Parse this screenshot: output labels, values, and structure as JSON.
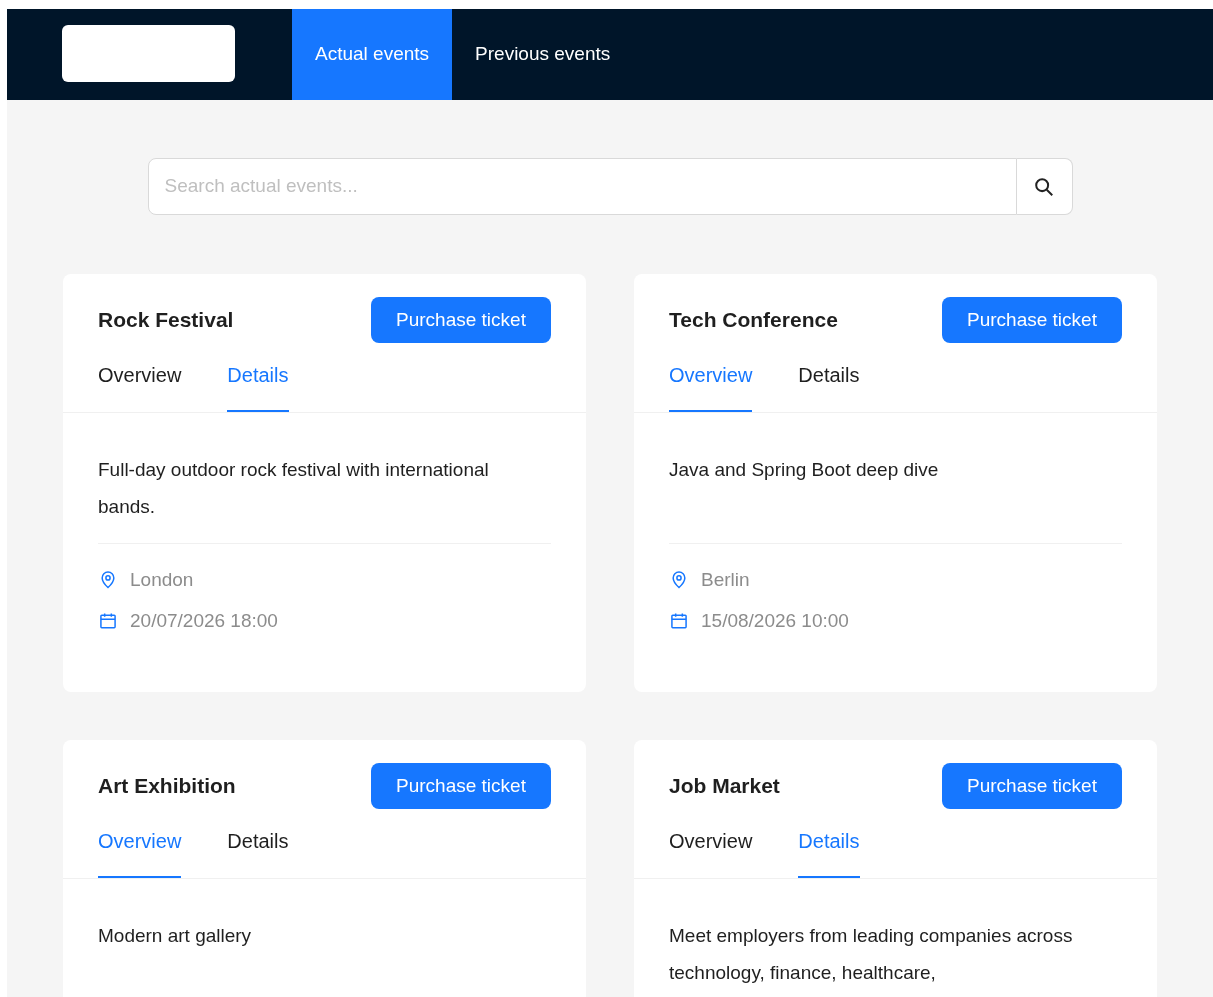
{
  "nav": {
    "tabs": [
      {
        "label": "Actual events",
        "selected": true
      },
      {
        "label": "Previous events",
        "selected": false
      }
    ]
  },
  "search": {
    "placeholder": "Search actual events..."
  },
  "events": [
    {
      "title": "Rock Festival",
      "button": "Purchase ticket",
      "tabs": [
        {
          "label": "Overview",
          "selected": false
        },
        {
          "label": "Details",
          "selected": true
        }
      ],
      "description": "Full-day outdoor rock festival with international bands.",
      "location": "London",
      "date": "20/07/2026 18:00"
    },
    {
      "title": "Tech Conference",
      "button": "Purchase ticket",
      "tabs": [
        {
          "label": "Overview",
          "selected": true
        },
        {
          "label": "Details",
          "selected": false
        }
      ],
      "description": "Java and Spring Boot deep dive",
      "location": "Berlin",
      "date": "15/08/2026 10:00"
    },
    {
      "title": "Art Exhibition",
      "button": "Purchase ticket",
      "tabs": [
        {
          "label": "Overview",
          "selected": true
        },
        {
          "label": "Details",
          "selected": false
        }
      ],
      "description": "Modern art gallery"
    },
    {
      "title": "Job Market",
      "button": "Purchase ticket",
      "tabs": [
        {
          "label": "Overview",
          "selected": false
        },
        {
          "label": "Details",
          "selected": true
        }
      ],
      "description": "Meet employers from leading companies across technology, finance, healthcare,"
    }
  ]
}
